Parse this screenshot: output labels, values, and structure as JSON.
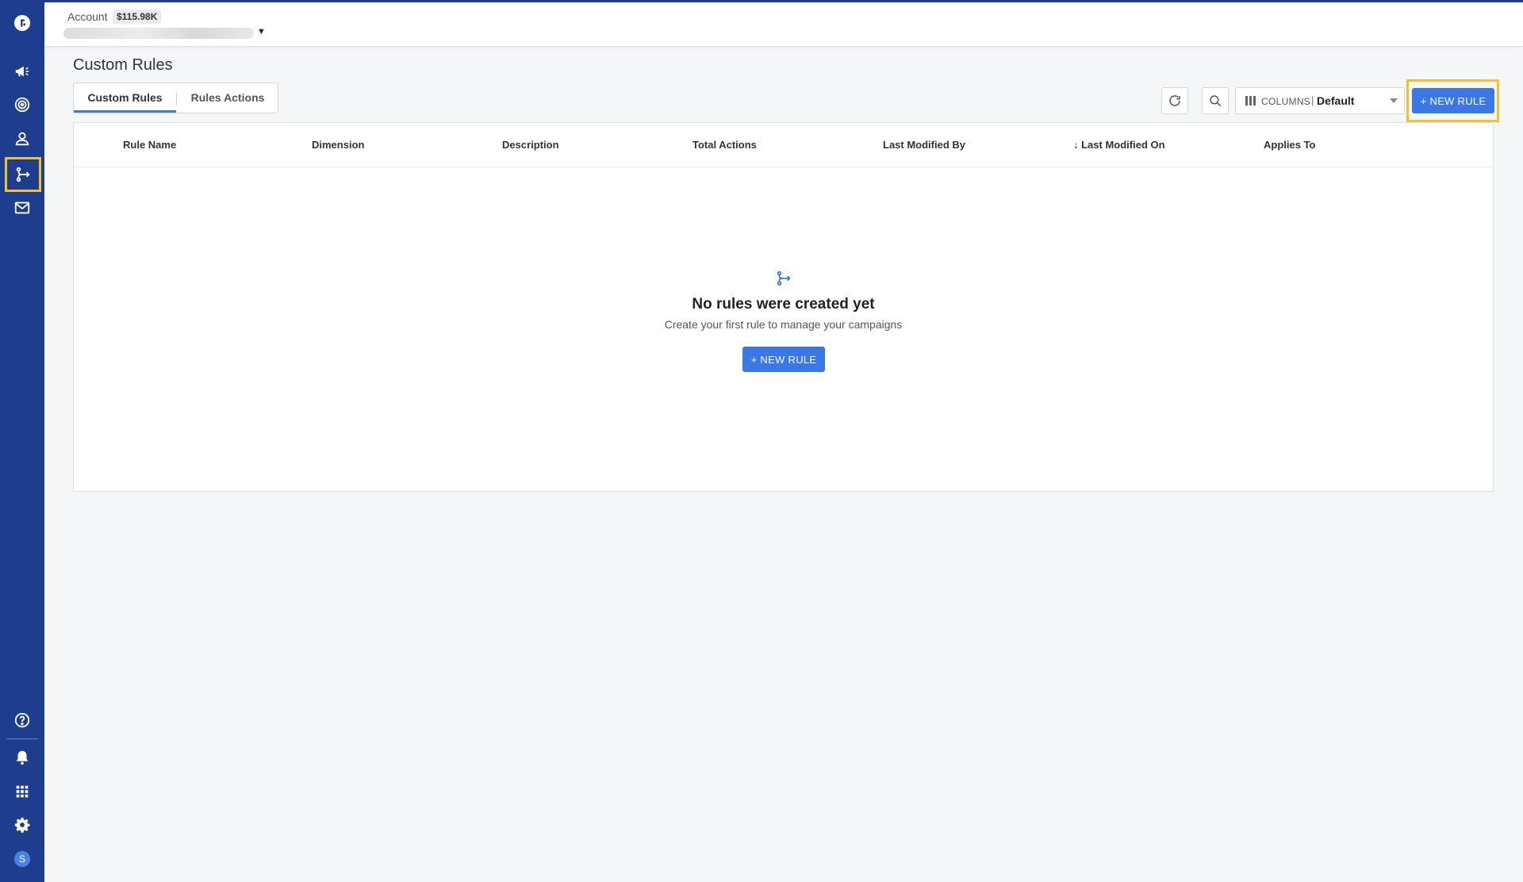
{
  "sidebar": {
    "top_items": [
      {
        "icon": "logo-icon"
      },
      {
        "icon": "megaphone-icon"
      },
      {
        "icon": "target-icon"
      },
      {
        "icon": "user-icon"
      },
      {
        "icon": "rules-icon",
        "active": true
      },
      {
        "icon": "mail-icon"
      }
    ],
    "bottom_items": [
      {
        "icon": "help-icon"
      },
      {
        "icon": "bell-icon"
      },
      {
        "icon": "apps-grid-icon"
      },
      {
        "icon": "gear-icon"
      },
      {
        "icon": "avatar",
        "letter": "S"
      }
    ],
    "accent_color": "#1e3d8f",
    "active_highlight_color": "#f2c12e"
  },
  "header": {
    "account_label": "Account",
    "account_balance": "$115.98K"
  },
  "page": {
    "title": "Custom Rules",
    "tabs": [
      {
        "label": "Custom Rules",
        "active": true
      },
      {
        "label": "Rules Actions",
        "active": false
      }
    ]
  },
  "toolbar": {
    "refresh_icon": "refresh-icon",
    "search_icon": "search-icon",
    "columns_label": "COLUMNS",
    "columns_separator": "|",
    "columns_value": "Default",
    "new_rule_label": "+ NEW RULE",
    "button_color": "#3b78e7"
  },
  "table": {
    "columns": [
      "Rule Name",
      "Dimension",
      "Description",
      "Total Actions",
      "Last Modified By",
      "↓ Last Modified On",
      "Applies To"
    ],
    "rows": []
  },
  "empty_state": {
    "icon": "rules-icon",
    "title": "No rules were created yet",
    "subtitle": "Create your first rule to manage your campaigns",
    "button_label": "+ NEW RULE"
  }
}
